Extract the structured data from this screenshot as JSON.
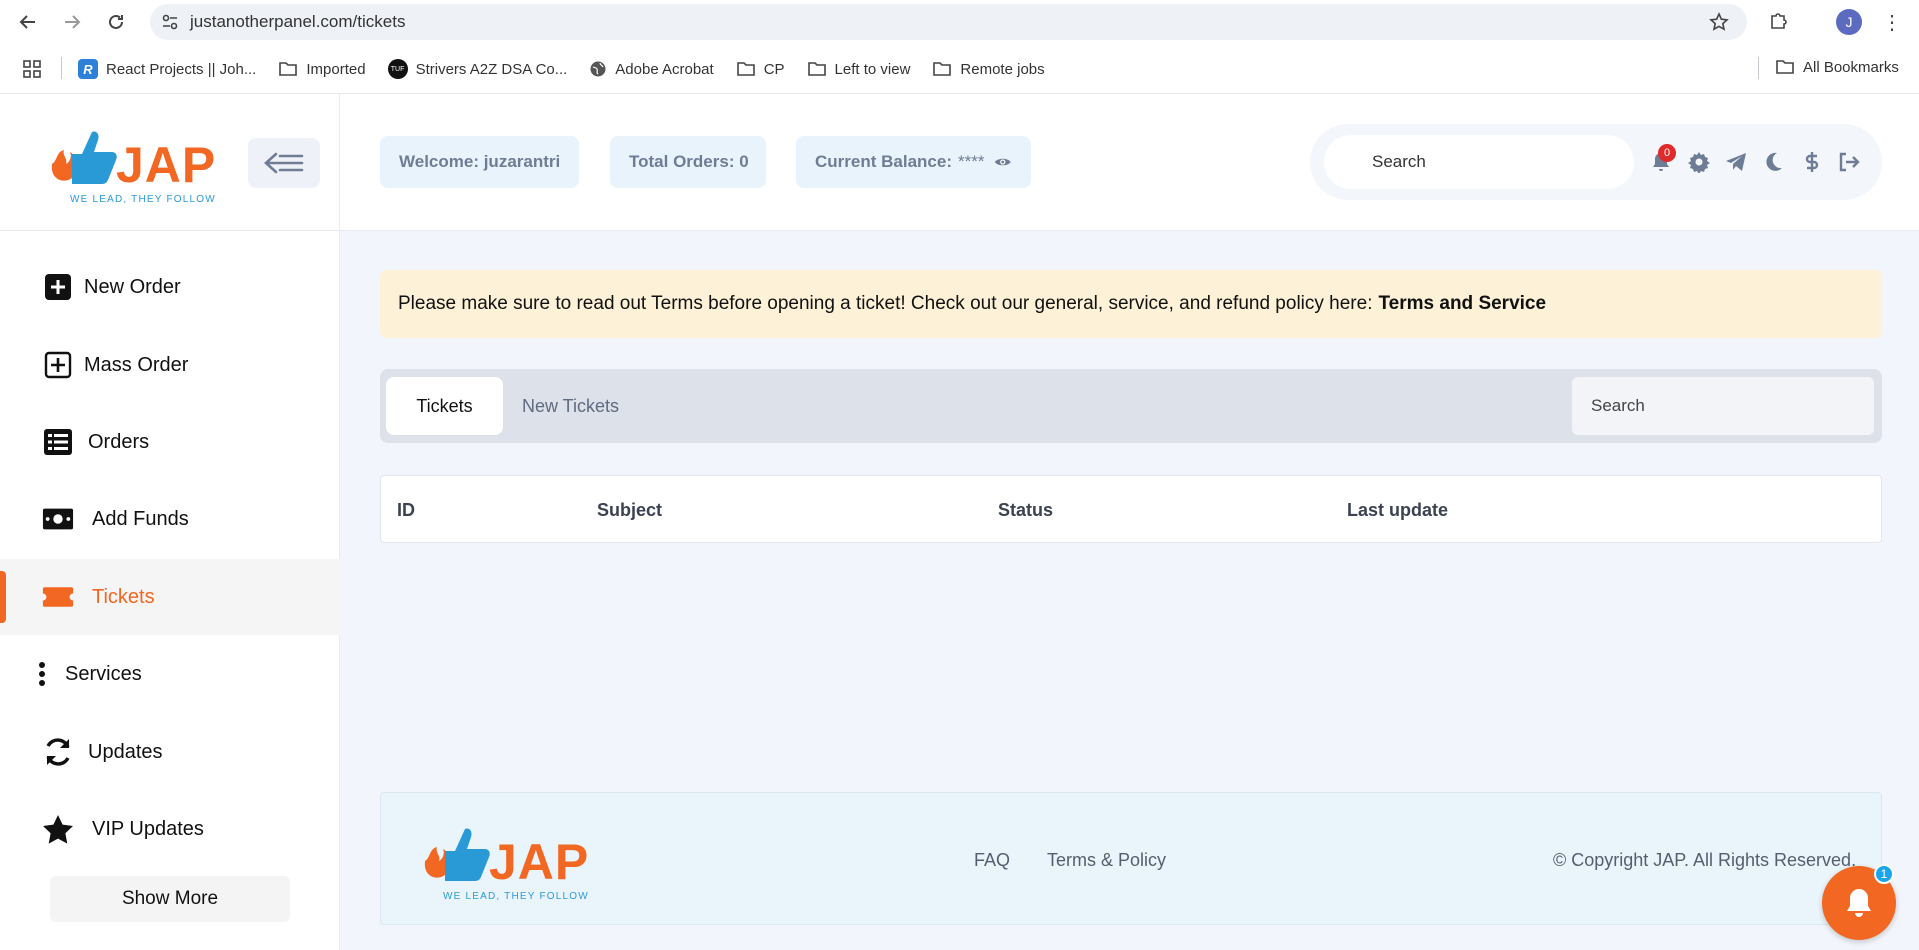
{
  "browser": {
    "url": "justanotherpanel.com/tickets",
    "profile_initial": "J",
    "bookmarks": [
      {
        "label": "React Projects || Joh...",
        "icon": "react-projects-favicon"
      },
      {
        "label": "Imported",
        "icon": "folder-icon"
      },
      {
        "label": "Strivers A2Z DSA Co...",
        "icon": "tuf-favicon"
      },
      {
        "label": "Adobe Acrobat",
        "icon": "globe-icon"
      },
      {
        "label": "CP",
        "icon": "folder-icon"
      },
      {
        "label": "Left to view",
        "icon": "folder-icon"
      },
      {
        "label": "Remote jobs",
        "icon": "folder-icon"
      }
    ],
    "all_bookmarks": "All Bookmarks",
    "react_favicon_letter": "R",
    "tuf_favicon_text": "TUF"
  },
  "header": {
    "logo_text": "JAP",
    "logo_tagline": "WE LEAD, THEY FOLLOW",
    "welcome": "Welcome: juzarantri",
    "total_orders": "Total Orders: 0",
    "balance_label": "Current Balance: ",
    "balance_value": "****",
    "search_placeholder": "Search",
    "notification_count": "0"
  },
  "sidebar": {
    "items": [
      {
        "label": "New Order",
        "icon": "plus-square-icon",
        "active": false
      },
      {
        "label": "Mass Order",
        "icon": "plus-square-outline-icon",
        "active": false
      },
      {
        "label": "Orders",
        "icon": "list-icon",
        "active": false
      },
      {
        "label": "Add Funds",
        "icon": "money-icon",
        "active": false
      },
      {
        "label": "Tickets",
        "icon": "ticket-icon",
        "active": true
      },
      {
        "label": "Services",
        "icon": "dots-vertical-icon",
        "active": false
      },
      {
        "label": "Updates",
        "icon": "refresh-icon",
        "active": false
      },
      {
        "label": "VIP Updates",
        "icon": "star-icon",
        "active": false
      }
    ],
    "show_more": "Show More"
  },
  "main": {
    "notice_text": "Please make sure to read out Terms before opening a ticket! Check out our general, service, and refund policy here:",
    "notice_link": "Terms and Service",
    "tabs": [
      {
        "label": "Tickets",
        "active": true
      },
      {
        "label": "New Tickets",
        "active": false
      }
    ],
    "search_placeholder": "Search",
    "table_headers": [
      "ID",
      "Subject",
      "Status",
      "Last update"
    ]
  },
  "footer": {
    "logo_text": "JAP",
    "logo_tagline": "WE LEAD, THEY FOLLOW",
    "links": [
      "FAQ",
      "Terms & Policy"
    ],
    "copyright": "© Copyright JAP. All Rights Reserved."
  },
  "fab": {
    "badge": "1"
  },
  "colors": {
    "brand_orange": "#f26722",
    "brand_blue": "#2a9ad6",
    "notice_bg": "#fdf1d7",
    "badge_red": "#e02b2b"
  }
}
